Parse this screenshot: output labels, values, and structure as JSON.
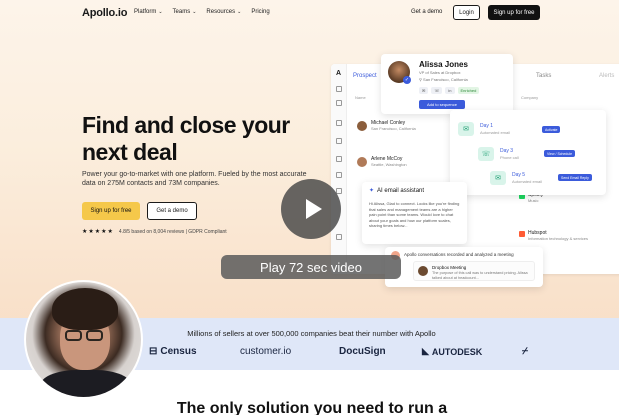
{
  "nav": {
    "logo": "Apollo.io",
    "links": [
      "Platform",
      "Teams",
      "Resources",
      "Pricing"
    ],
    "get_demo": "Get a demo",
    "login": "Login",
    "signup": "Sign up for free"
  },
  "hero": {
    "title": "Find and close your next deal",
    "subtitle": "Power your go-to-market with one platform. Fueled by the most accurate data on 275M contacts and 73M companies.",
    "signup_button": "Sign up for free",
    "demo_button": "Get a demo",
    "stars": "★★★★★",
    "rating_text": "4.8/5 based on 8,004 reviews | GDPR Compliant"
  },
  "app": {
    "tab": "Prospect",
    "tasks": "Tasks",
    "alerts": "Alerts",
    "col_name": "Name",
    "col_company": "Company",
    "rows": [
      {
        "name": "Michael Conley",
        "sub": "San Francisco, California"
      },
      {
        "name": "Arlene McCoy",
        "sub": "Seattle, Washington"
      }
    ],
    "companies": [
      {
        "name": "Spotify",
        "sub": "Music"
      },
      {
        "name": "Hubspot",
        "sub": "Information technology & services"
      }
    ]
  },
  "profile": {
    "name": "Alissa Jones",
    "title": "VP of Sales at Dropbox",
    "location": "San Francisco, California",
    "tag_status": "Enriched",
    "action": "Add to sequence"
  },
  "sequence": {
    "steps": [
      {
        "label": "Day 1",
        "sub": "Automated email",
        "pill": "Activate"
      },
      {
        "label": "Day 3",
        "sub": "Phone call",
        "pill": "View / Schedule"
      },
      {
        "label": "Day 5",
        "sub": "Automated email",
        "pill": "Send Email Reply"
      }
    ]
  },
  "email": {
    "title": "AI email assistant",
    "body": "Hi Alissa, Glad to connect. Looks like you're finding that sales and management teams are a higher pain point than some teams. Would love to chat about your goals and how our platform scales, sharing times below..."
  },
  "conversation": {
    "title": "Apollo conversations recorded and analyzed a meeting",
    "meeting": "Dropbox Meeting",
    "text": "The purpose of this call was to understand pricing. Alissa talked about at headcount..."
  },
  "video": {
    "label": "Play 72 sec video"
  },
  "band": {
    "title": "Millions of sellers at over 500,000 companies beat their number with Apollo",
    "logos": [
      "Census",
      "customer.io",
      "DocuSign",
      "AUTODESK"
    ]
  },
  "bottom": {
    "title": "The only solution you need to run a"
  }
}
